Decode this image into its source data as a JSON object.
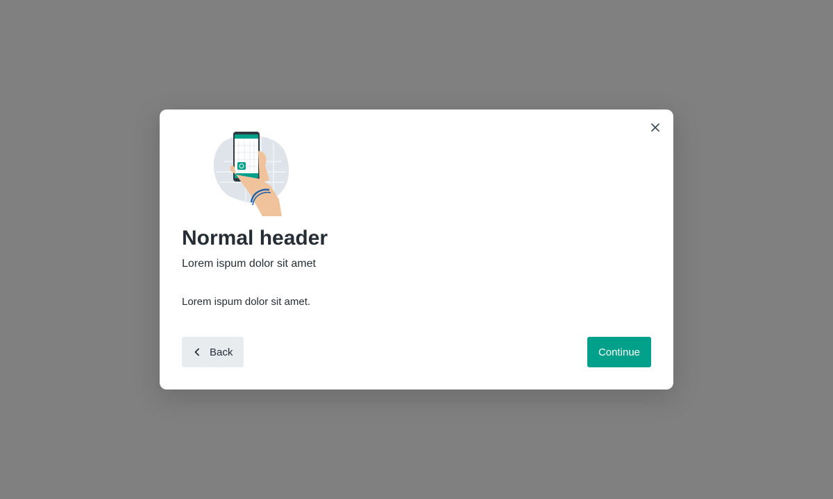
{
  "modal": {
    "title": "Normal header",
    "subtitle": "Lorem ispum dolor sit amet",
    "body": "Lorem ispum dolor sit amet.",
    "back_label": "Back",
    "continue_label": "Continue",
    "close_icon": "close-icon",
    "back_icon": "chevron-left-icon",
    "illustration": "hand-holding-phone-illustration"
  },
  "colors": {
    "backdrop": "#808080",
    "primary": "#00a08a",
    "secondary_button": "#e8ecef",
    "text": "#262d34"
  }
}
